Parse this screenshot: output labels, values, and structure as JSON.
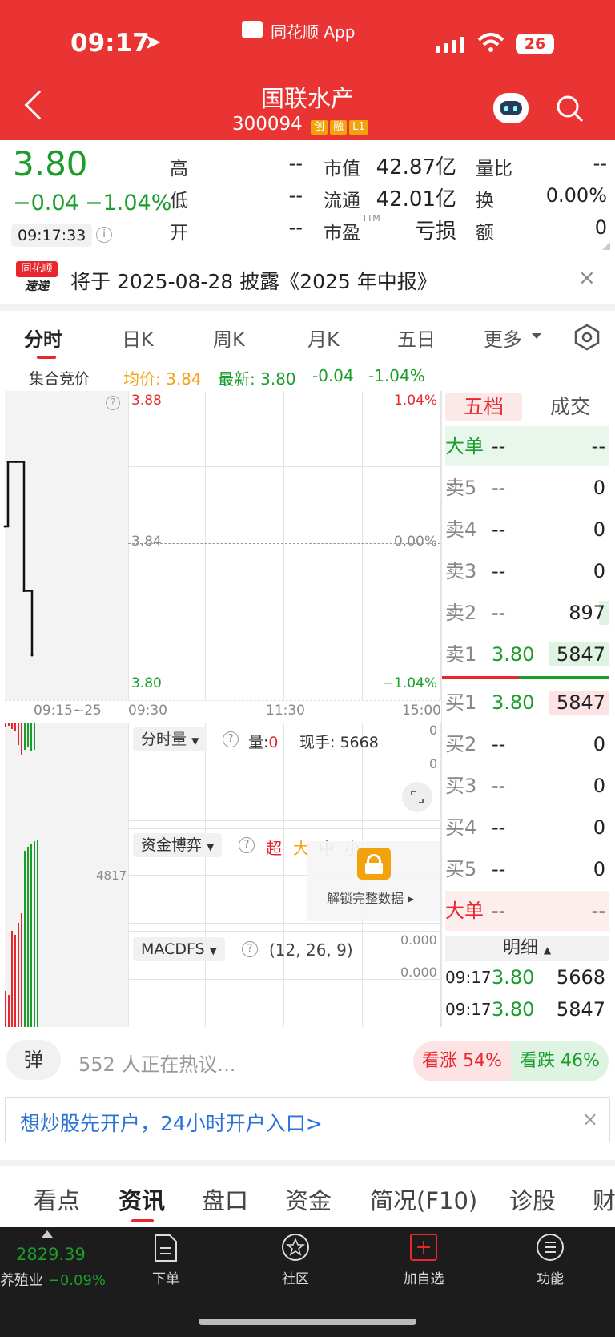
{
  "status_bar": {
    "time": "09:17",
    "source_app": "同花顺 App",
    "battery": "26"
  },
  "header": {
    "stock_name": "国联水产",
    "stock_code": "300094",
    "badges": [
      "创",
      "融",
      "L1"
    ]
  },
  "quote": {
    "price": "3.80",
    "change": "−0.04",
    "change_pct": "−1.04%",
    "time": "09:17:33",
    "high_label": "高",
    "high": "--",
    "low_label": "低",
    "low": "--",
    "open_label": "开",
    "open": "--",
    "mktcap_label": "市值",
    "mktcap": "42.87亿",
    "float_label": "流通",
    "float": "42.01亿",
    "pe_label": "市盈",
    "pe_sup": "TTM",
    "pe": "亏损",
    "volratio_label": "量比",
    "volratio": "--",
    "turnover_label": "换",
    "turnover": "0.00%",
    "amount_label": "额",
    "amount": "0"
  },
  "notice": {
    "logo_top": "同花顺",
    "logo_bottom": "速递",
    "text": "将于 2025-08-28 披露《2025 年中报》"
  },
  "chart_tabs": [
    "分时",
    "日K",
    "周K",
    "月K",
    "五日",
    "更多"
  ],
  "chart_header": {
    "auction": "集合竞价",
    "avg": "均价: 3.84",
    "latest": "最新: 3.80",
    "chg": "-0.04",
    "chg_pct": "-1.04%"
  },
  "chart_axis": {
    "top": "3.88",
    "mid": "3.84",
    "bottom": "3.80",
    "top_pct": "1.04%",
    "mid_pct": "0.00%",
    "bottom_pct": "−1.04%",
    "times": [
      "09:15~25",
      "09:30",
      "11:30",
      "15:00"
    ]
  },
  "chart_data": {
    "type": "line",
    "x": [
      "09:15",
      "09:17",
      "09:20",
      "09:22",
      "09:25"
    ],
    "y": [
      3.84,
      3.86,
      3.86,
      3.82,
      3.8
    ],
    "ylim": [
      3.8,
      3.88
    ],
    "volume_axis_label": "4817"
  },
  "volume_panel": {
    "selector": "分时量",
    "vol_label": "量:",
    "vol": "0",
    "hand_label": "现手:",
    "hand": "5668",
    "right_top": "0",
    "right_bottom": "0"
  },
  "fund_panel": {
    "selector": "资金博弈",
    "legend": [
      "超",
      "大",
      "中",
      "小"
    ],
    "unlock": "解锁完整数据"
  },
  "macd_panel": {
    "selector": "MACDFS",
    "params": "(12, 26, 9)",
    "v1": "0.000",
    "v2": "0.000"
  },
  "orderbook": {
    "tabs": [
      "五档",
      "成交"
    ],
    "big_sell": {
      "label": "大单",
      "a": "--",
      "b": "--"
    },
    "sells": [
      {
        "label": "卖5",
        "price": "--",
        "vol": "0"
      },
      {
        "label": "卖4",
        "price": "--",
        "vol": "0"
      },
      {
        "label": "卖3",
        "price": "--",
        "vol": "0"
      },
      {
        "label": "卖2",
        "price": "--",
        "vol": "897"
      },
      {
        "label": "卖1",
        "price": "3.80",
        "vol": "5847"
      }
    ],
    "buys": [
      {
        "label": "买1",
        "price": "3.80",
        "vol": "5847"
      },
      {
        "label": "买2",
        "price": "--",
        "vol": "0"
      },
      {
        "label": "买3",
        "price": "--",
        "vol": "0"
      },
      {
        "label": "买4",
        "price": "--",
        "vol": "0"
      },
      {
        "label": "买5",
        "price": "--",
        "vol": "0"
      }
    ],
    "big_buy": {
      "label": "大单",
      "a": "--",
      "b": "--"
    },
    "detail_label": "明细",
    "details": [
      {
        "time": "09:17",
        "price": "3.80",
        "vol": "5668"
      },
      {
        "time": "09:17",
        "price": "3.80",
        "vol": "5847"
      }
    ]
  },
  "discussion": {
    "danmu": "弹",
    "text": "552 人正在热议...",
    "up": "看涨 54%",
    "down": "看跌 46%"
  },
  "open_account": {
    "text": "想炒股先开户，24小时开户入口>"
  },
  "bottom_tabs": [
    "看点",
    "资讯",
    "盘口",
    "资金",
    "简况(F10)",
    "诊股",
    "财"
  ],
  "footer": {
    "index_value": "2829.39",
    "index_name": "养殖业",
    "index_chg": "−0.09%",
    "items": [
      "下单",
      "社区",
      "加自选",
      "功能"
    ]
  },
  "colors": {
    "header_red": "#ea3434",
    "down_green": "#1a9d2a",
    "up_red": "#e8262e"
  }
}
